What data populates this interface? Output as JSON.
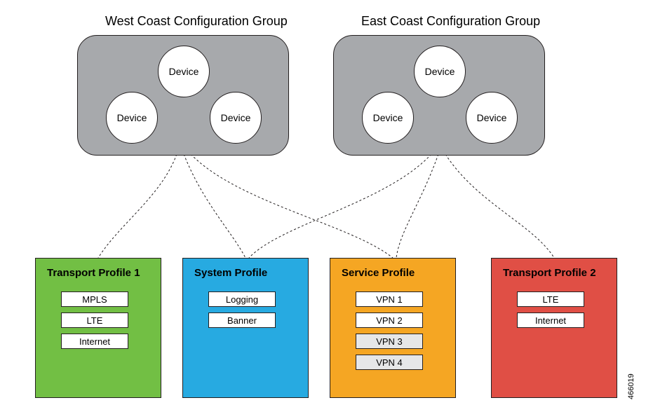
{
  "groups": {
    "west": {
      "title": "West Coast Configuration Group",
      "devices": [
        "Device",
        "Device",
        "Device"
      ]
    },
    "east": {
      "title": "East Coast Configuration Group",
      "devices": [
        "Device",
        "Device",
        "Device"
      ]
    }
  },
  "profiles": {
    "transport1": {
      "title": "Transport Profile 1",
      "color": "#72bf44",
      "items": [
        {
          "label": "MPLS",
          "muted": false
        },
        {
          "label": "LTE",
          "muted": false
        },
        {
          "label": "Internet",
          "muted": false
        }
      ]
    },
    "system": {
      "title": "System Profile",
      "color": "#27aae1",
      "items": [
        {
          "label": "Logging",
          "muted": false
        },
        {
          "label": "Banner",
          "muted": false
        }
      ]
    },
    "service": {
      "title": "Service Profile",
      "color": "#f5a623",
      "items": [
        {
          "label": "VPN 1",
          "muted": false
        },
        {
          "label": "VPN 2",
          "muted": false
        },
        {
          "label": "VPN 3",
          "muted": true
        },
        {
          "label": "VPN 4",
          "muted": true
        }
      ]
    },
    "transport2": {
      "title": "Transport Profile 2",
      "color": "#e04f45",
      "items": [
        {
          "label": "LTE",
          "muted": false
        },
        {
          "label": "Internet",
          "muted": false
        }
      ]
    }
  },
  "connections": {
    "west": [
      "transport1",
      "system",
      "service"
    ],
    "east": [
      "system",
      "service",
      "transport2"
    ]
  },
  "ref_id": "466019"
}
